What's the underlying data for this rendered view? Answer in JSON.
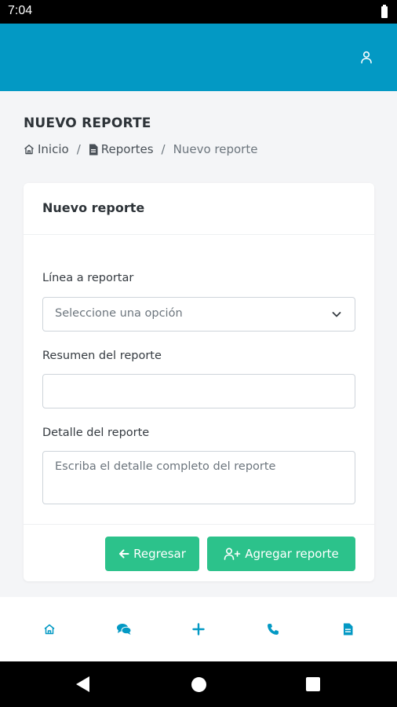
{
  "status_bar": {
    "time": "7:04"
  },
  "header": {
    "icons": [
      "user-icon"
    ],
    "color": "#0399c4"
  },
  "page": {
    "title": "NUEVO REPORTE",
    "breadcrumb": {
      "home": "Inicio",
      "reports": "Reportes",
      "current": "Nuevo reporte",
      "separator": "/"
    }
  },
  "card": {
    "title": "Nuevo reporte",
    "form": {
      "line_label": "Línea a reportar",
      "line_value": "Seleccione una opción",
      "summary_label": "Resumen del reporte",
      "summary_value": "",
      "detail_label": "Detalle del reporte",
      "detail_placeholder": "Escriba el detalle completo del reporte"
    },
    "buttons": {
      "back": "Regresar",
      "add": "Agregar reporte",
      "color": "#2cc28b"
    }
  },
  "bottom_nav": {
    "items": [
      "home-icon",
      "chat-icon",
      "plus-icon",
      "phone-icon",
      "document-icon"
    ],
    "color": "#0399c4"
  }
}
